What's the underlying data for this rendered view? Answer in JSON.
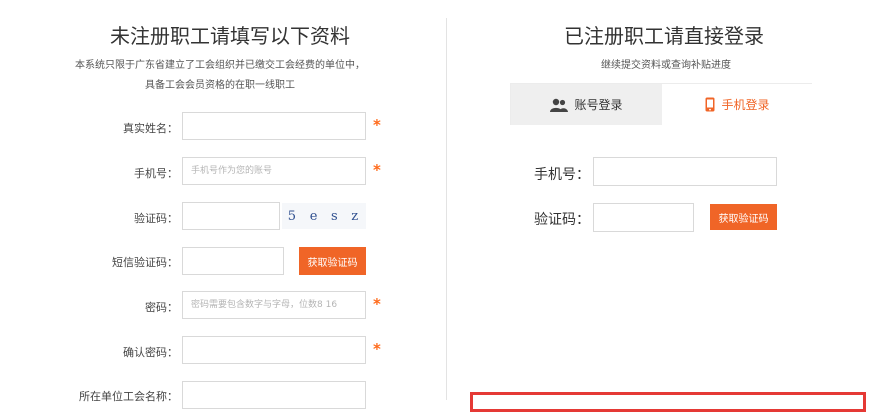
{
  "left": {
    "title": "未注册职工请填写以下资料",
    "desc_line1": "本系统只限于广东省建立了工会组织并已缴交工会经费的单位中，",
    "desc_line2": "具备工会会员资格的在职一线职工",
    "real_name_label": "真实姓名：",
    "phone_label": "手机号：",
    "phone_placeholder": "手机号作为您的账号",
    "captcha_label": "验证码：",
    "captcha_text": [
      "5",
      "e",
      "s",
      "z"
    ],
    "sms_label": "短信验证码：",
    "get_code_button": "获取验证码",
    "password_label": "密码：",
    "password_placeholder": "密码需要包含数字与字母，位数8 16",
    "confirm_password_label": "确认密码：",
    "union_label": "所在单位工会名称：",
    "required_mark": "*"
  },
  "right": {
    "title": "已注册职工请直接登录",
    "subtitle": "继续提交资料或查询补贴进度",
    "tab_account": "账号登录",
    "tab_mobile": "手机登录",
    "phone_label": "手机号：",
    "code_label": "验证码：",
    "get_code_button": "获取验证码"
  },
  "colors": {
    "accent": "#f06527",
    "required": "#ff6a1a",
    "highlight_border": "#e53935",
    "tab_inactive_bg": "#efefef"
  },
  "icons": {
    "account_tab": "users-icon",
    "mobile_tab": "phone-icon"
  }
}
